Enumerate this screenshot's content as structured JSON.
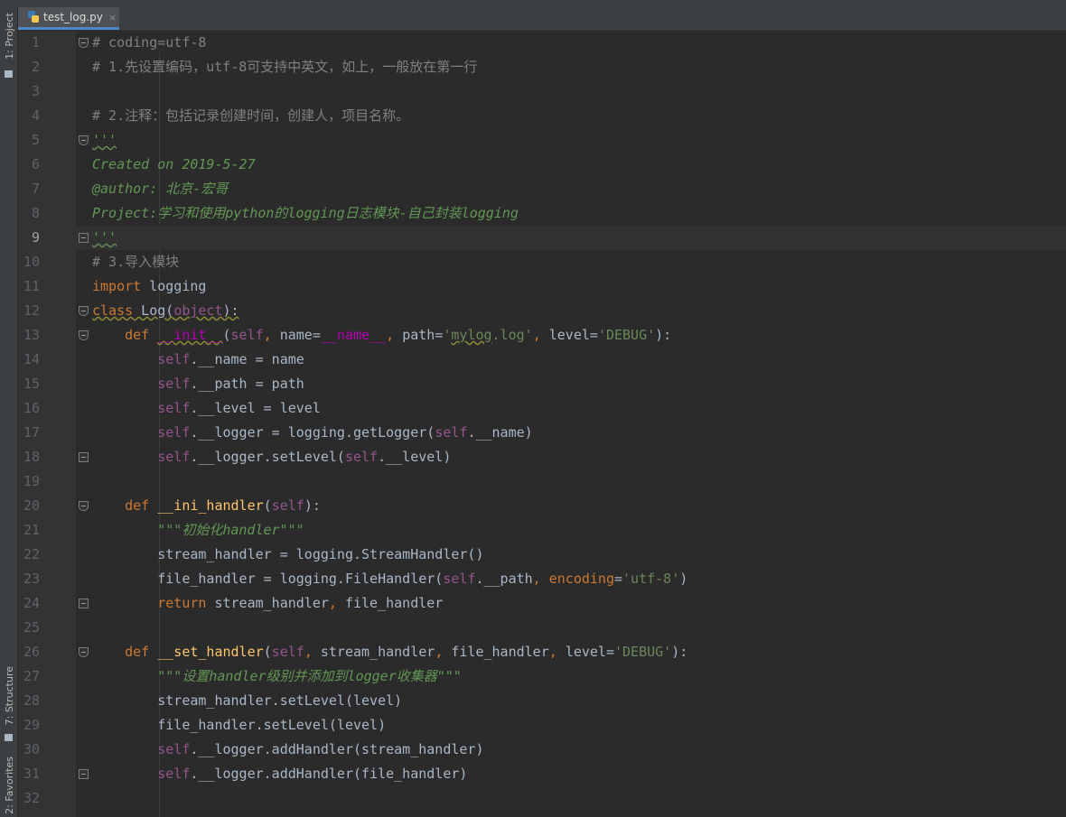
{
  "sidebar": {
    "project_label": "1: Project",
    "structure_label": "7: Structure",
    "favorites_label": "2: Favorites"
  },
  "tab": {
    "title": "test_log.py",
    "close": "×"
  },
  "editor": {
    "current_line": 9
  },
  "colors": {
    "background": "#2b2b2b",
    "keyword": "#cc7832",
    "function": "#ffc66d",
    "self": "#94558d",
    "string": "#6a8759",
    "comment": "#808080",
    "docstring": "#629755",
    "magic": "#b200b2"
  },
  "lines": [
    {
      "n": "1",
      "fold": "open",
      "t": [
        [
          "cmt",
          "# coding=utf-8"
        ]
      ]
    },
    {
      "n": "2",
      "t": [
        [
          "cmt",
          "# 1.先设置编码，utf-8可支持中英文，如上，一般放在第一行"
        ]
      ]
    },
    {
      "n": "3",
      "t": []
    },
    {
      "n": "4",
      "t": [
        [
          "cmt",
          "# 2.注释：包括记录创建时间，创建人，项目名称。"
        ]
      ]
    },
    {
      "n": "5",
      "fold": "open",
      "t": [
        [
          "doc squig-g",
          "'''"
        ]
      ]
    },
    {
      "n": "6",
      "t": [
        [
          "doc",
          "Created on 2019-5-27"
        ]
      ]
    },
    {
      "n": "7",
      "t": [
        [
          "doc",
          "@author: 北京-宏哥"
        ]
      ]
    },
    {
      "n": "8",
      "t": [
        [
          "doc",
          "Project:学习和使用python的logging日志模块-自己封装logging"
        ]
      ]
    },
    {
      "n": "9",
      "fold": "end",
      "t": [
        [
          "doc squig-g",
          "'''"
        ]
      ]
    },
    {
      "n": "10",
      "t": [
        [
          "cmt",
          "# 3.导入模块"
        ]
      ]
    },
    {
      "n": "11",
      "t": [
        [
          "kw",
          "import"
        ],
        [
          "",
          " logging"
        ]
      ]
    },
    {
      "n": "12",
      "fold": "open",
      "t": [
        [
          "kw squig",
          "class"
        ],
        [
          "squig",
          " Log("
        ],
        [
          "selfk squig",
          "object"
        ],
        [
          "squig",
          "):"
        ]
      ]
    },
    {
      "n": "13",
      "fold": "open",
      "t": [
        [
          "",
          "    "
        ],
        [
          "kw",
          "def "
        ],
        [
          "magic squig",
          "__init__"
        ],
        [
          "",
          "("
        ],
        [
          "selfk",
          "self"
        ],
        [
          "kw",
          ", "
        ],
        [
          "",
          "name="
        ],
        [
          "magic",
          "__name__"
        ],
        [
          "kw",
          ", "
        ],
        [
          "",
          "path="
        ],
        [
          "str",
          "'"
        ],
        [
          "str squig",
          "mylog"
        ],
        [
          "str",
          ".log'"
        ],
        [
          "kw",
          ", "
        ],
        [
          "",
          "level="
        ],
        [
          "str",
          "'DEBUG'"
        ],
        [
          "",
          "):"
        ]
      ]
    },
    {
      "n": "14",
      "t": [
        [
          "",
          "        "
        ],
        [
          "selfk",
          "self"
        ],
        [
          "",
          ".__name = name"
        ]
      ]
    },
    {
      "n": "15",
      "t": [
        [
          "",
          "        "
        ],
        [
          "selfk",
          "self"
        ],
        [
          "",
          ".__path = path"
        ]
      ]
    },
    {
      "n": "16",
      "t": [
        [
          "",
          "        "
        ],
        [
          "selfk",
          "self"
        ],
        [
          "",
          ".__level = level"
        ]
      ]
    },
    {
      "n": "17",
      "t": [
        [
          "",
          "        "
        ],
        [
          "selfk",
          "self"
        ],
        [
          "",
          ".__logger = logging.getLogger("
        ],
        [
          "selfk",
          "self"
        ],
        [
          "",
          ".__name)"
        ]
      ]
    },
    {
      "n": "18",
      "fold": "end",
      "t": [
        [
          "",
          "        "
        ],
        [
          "selfk",
          "self"
        ],
        [
          "",
          ".__logger.setLevel("
        ],
        [
          "selfk",
          "self"
        ],
        [
          "",
          ".__level)"
        ]
      ]
    },
    {
      "n": "19",
      "t": []
    },
    {
      "n": "20",
      "fold": "open",
      "t": [
        [
          "",
          "    "
        ],
        [
          "kw",
          "def "
        ],
        [
          "fn",
          "__ini_handler"
        ],
        [
          "",
          "("
        ],
        [
          "selfk",
          "self"
        ],
        [
          "",
          "):"
        ]
      ]
    },
    {
      "n": "21",
      "t": [
        [
          "",
          "        "
        ],
        [
          "doc",
          "\"\"\"初始化handler\"\"\""
        ]
      ]
    },
    {
      "n": "22",
      "t": [
        [
          "",
          "        stream_handler = logging.StreamHandler()"
        ]
      ]
    },
    {
      "n": "23",
      "t": [
        [
          "",
          "        file_handler = logging.FileHandler("
        ],
        [
          "selfk",
          "self"
        ],
        [
          "",
          ".__path"
        ],
        [
          "kw",
          ", "
        ],
        [
          "kw",
          "encoding"
        ],
        [
          "",
          "="
        ],
        [
          "str",
          "'utf-8'"
        ],
        [
          "",
          ")"
        ]
      ]
    },
    {
      "n": "24",
      "fold": "end",
      "t": [
        [
          "",
          "        "
        ],
        [
          "kw",
          "return "
        ],
        [
          "",
          "stream_handler"
        ],
        [
          "kw",
          ", "
        ],
        [
          "",
          "file_handler"
        ]
      ]
    },
    {
      "n": "25",
      "t": []
    },
    {
      "n": "26",
      "fold": "open",
      "t": [
        [
          "",
          "    "
        ],
        [
          "kw",
          "def "
        ],
        [
          "fn",
          "__set_handler"
        ],
        [
          "",
          "("
        ],
        [
          "selfk",
          "self"
        ],
        [
          "kw",
          ", "
        ],
        [
          "",
          "stream_handler"
        ],
        [
          "kw",
          ", "
        ],
        [
          "",
          "file_handler"
        ],
        [
          "kw",
          ", "
        ],
        [
          "",
          "level="
        ],
        [
          "str",
          "'DEBUG'"
        ],
        [
          "",
          "):"
        ]
      ]
    },
    {
      "n": "27",
      "t": [
        [
          "",
          "        "
        ],
        [
          "doc",
          "\"\"\"设置handler级别并添加到logger收集器\"\"\""
        ]
      ]
    },
    {
      "n": "28",
      "t": [
        [
          "",
          "        stream_handler.setLevel(level)"
        ]
      ]
    },
    {
      "n": "29",
      "t": [
        [
          "",
          "        file_handler.setLevel(level)"
        ]
      ]
    },
    {
      "n": "30",
      "t": [
        [
          "",
          "        "
        ],
        [
          "selfk",
          "self"
        ],
        [
          "",
          ".__logger.addHandler(stream_handler)"
        ]
      ]
    },
    {
      "n": "31",
      "fold": "end",
      "t": [
        [
          "",
          "        "
        ],
        [
          "selfk",
          "self"
        ],
        [
          "",
          ".__logger.addHandler(file_handler)"
        ]
      ]
    },
    {
      "n": "32",
      "t": []
    }
  ]
}
